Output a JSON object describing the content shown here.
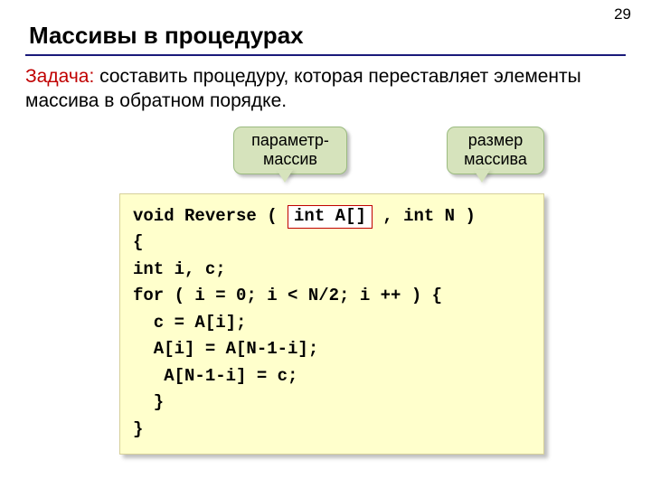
{
  "page_number": "29",
  "title": "Массивы в процедурах",
  "task": {
    "label": "Задача:",
    "text": " составить процедуру, которая переставляет элементы массива в обратном порядке."
  },
  "callouts": {
    "param_array": "параметр-массив",
    "array_size": "размер массива"
  },
  "code": {
    "l1a": "void Reverse ( ",
    "l1_hl": "int A[]",
    "l1b": " , int N )",
    "l2": "{",
    "l3": "int i, c;",
    "l4": "for ( i = 0; i < N/2; i ++ ) {",
    "l5": "  c = A[i];",
    "l6": "  A[i] = A[N-1-i];",
    "l7": "   A[N-1-i] = c;",
    "l8": "  }",
    "l9": "}"
  }
}
